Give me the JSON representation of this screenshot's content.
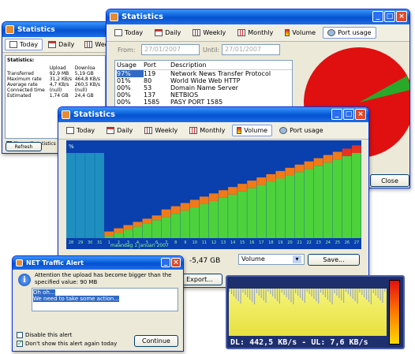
{
  "small_window": {
    "title": "Statistics",
    "tabs": [
      "Today",
      "Daily",
      "Weekly"
    ],
    "section": "Statistics:",
    "columns": [
      "",
      "Upload",
      "Downloa"
    ],
    "rows": [
      [
        "Transferred",
        "92,9 MB",
        "5,19 GB"
      ],
      [
        "Maximum rate",
        "31,2 KB/s",
        "464,8 KB/s"
      ],
      [
        "Average rate",
        "4,7 KB/s",
        "260,5 KB/s"
      ],
      [
        "Connected time",
        "(null)",
        "(null)"
      ],
      [
        "Estimated",
        "1,74 GB",
        "24,4 GB"
      ]
    ],
    "show_all": "Show all statistics",
    "refresh": "Refresh"
  },
  "main_window": {
    "title": "Statistics",
    "tabs": [
      "Today",
      "Daily",
      "Weekly",
      "Monthly",
      "Volume",
      "Port usage"
    ],
    "from_label": "From:",
    "from_value": "27/01/2007",
    "until_label": "Until:",
    "until_value": "27/01/2007",
    "columns": [
      "Usage",
      "Port",
      "Description"
    ],
    "rows": [
      [
        "97%",
        "119",
        "Network News Transfer Protocol"
      ],
      [
        "01%",
        "80",
        "World Wide Web HTTP"
      ],
      [
        "00%",
        "53",
        "Domain Name Server"
      ],
      [
        "00%",
        "137",
        "NETBIOS"
      ],
      [
        "00%",
        "1585",
        "PASY PORT 1585"
      ]
    ],
    "close": "Close"
  },
  "volume_window": {
    "title": "Statistics",
    "tabs": [
      "Today",
      "Daily",
      "Weekly",
      "Monthly",
      "Volume",
      "Port usage"
    ],
    "axis_top_label": "%",
    "day_labels": [
      "28",
      "29",
      "30",
      "31",
      "1",
      "2",
      "3",
      "4",
      "5",
      "6",
      "7",
      "8",
      "9",
      "10",
      "11",
      "12",
      "13",
      "14",
      "15",
      "16",
      "17",
      "18",
      "19",
      "20",
      "21",
      "22",
      "23",
      "24",
      "25",
      "26",
      "27"
    ],
    "date_caption": "maandag 1 januari 2007",
    "total_value": "-5,47 GB",
    "select_value": "Volume",
    "save": "Save...",
    "export": "Export...",
    "colors": {
      "upload": "#e8321f",
      "download": "#4dd23c",
      "background": "#0a3fae"
    }
  },
  "alert_window": {
    "title": "NET Traffic Alert",
    "message": "Attention the upload has become bigger than the specified value: 90 MB",
    "text_lines": [
      "Oh oh...",
      "We need to take some action..."
    ],
    "disable_label": "Disable this alert",
    "dont_show_label": "Don't show this alert again today",
    "dont_show_checked": true,
    "continue": "Continue"
  },
  "meter_widget": {
    "readout": "DL: 442,5 KB/s - UL: 7,6 KB/s"
  },
  "pie": {
    "colors": {
      "main": "#e01010",
      "slice": "#2aa82a"
    }
  }
}
